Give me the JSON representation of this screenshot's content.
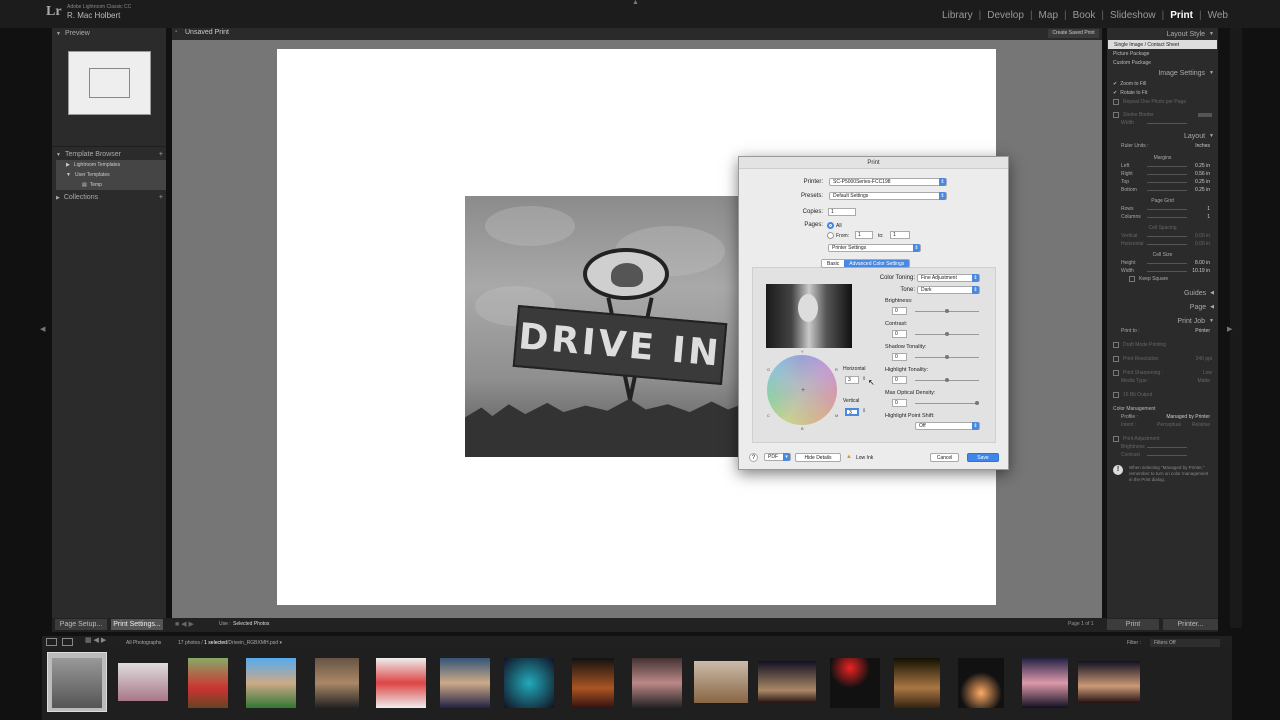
{
  "app": {
    "logo": "Lr",
    "name": "Adobe Lightroom Classic CC",
    "user": "R. Mac Holbert"
  },
  "modules": [
    {
      "label": "Library"
    },
    {
      "label": "Develop"
    },
    {
      "label": "Map"
    },
    {
      "label": "Book"
    },
    {
      "label": "Slideshow"
    },
    {
      "label": "Print",
      "active": true
    },
    {
      "label": "Web"
    }
  ],
  "left_panel": {
    "preview_title": "Preview",
    "template_browser_title": "Template Browser",
    "template_items": [
      "Lightroom Templates",
      "User Templates",
      "Temp"
    ],
    "collections_title": "Collections"
  },
  "center": {
    "title": "Unsaved Print",
    "create_saved": "Create Saved Print",
    "sign_text": "DRIVE IN"
  },
  "right_panel": {
    "layout_style_title": "Layout Style",
    "layout_styles": [
      "Single Image / Contact Sheet",
      "Picture Package",
      "Custom Package"
    ],
    "image_settings_title": "Image Settings",
    "image_settings": [
      {
        "label": "Zoom to Fill",
        "checked": true
      },
      {
        "label": "Rotate to Fit",
        "checked": true
      },
      {
        "label": "Repeat One Photo per Page",
        "checked": false
      },
      {
        "label": "Stroke Border",
        "checked": false
      }
    ],
    "stroke_width_label": "Width",
    "layout_title": "Layout",
    "ruler_units_label": "Ruler Units :",
    "ruler_units_value": "Inches",
    "margins_label": "Margins",
    "margins": [
      {
        "label": "Left",
        "value": "0.25 in"
      },
      {
        "label": "Right",
        "value": "0.56 in"
      },
      {
        "label": "Top",
        "value": "0.25 in"
      },
      {
        "label": "Bottom",
        "value": "0.25 in"
      }
    ],
    "page_grid_label": "Page Grid",
    "page_grid": [
      {
        "label": "Rows",
        "value": "1"
      },
      {
        "label": "Columns",
        "value": "1"
      }
    ],
    "cell_spacing_label": "Cell Spacing",
    "cell_spacing": [
      {
        "label": "Vertical",
        "value": "0.00 in"
      },
      {
        "label": "Horizontal",
        "value": "0.00 in"
      }
    ],
    "cell_size_label": "Cell Size",
    "cell_size": [
      {
        "label": "Height",
        "value": "8.00 in"
      },
      {
        "label": "Width",
        "value": "10.19 in"
      }
    ],
    "keep_square_label": "Keep Square",
    "guides_title": "Guides",
    "page_title": "Page",
    "print_job_title": "Print Job",
    "print_to_label": "Print to :",
    "print_to_value": "Printer",
    "draft_mode": "Draft Mode Printing",
    "print_resolution": "Print Resolution",
    "print_resolution_value": "240 ppi",
    "print_sharpening": "Print Sharpening :",
    "print_sharpening_value": "Low",
    "media_type": "Media Type :",
    "media_type_value": "Matte",
    "bit_output": "16 Bit Output",
    "color_management": "Color Management",
    "profile_label": "Profile :",
    "profile_value": "Managed by Printer",
    "intent_label": "Intent :",
    "intent_perceptual": "Perceptual",
    "intent_relative": "Relative",
    "print_adjustment": "Print Adjustment",
    "brightness_label": "Brightness",
    "contrast_label": "Contrast",
    "note": "When selecting \"Managed by Printer,\" remember to turn on color management in the Print dialog."
  },
  "bottom": {
    "page_setup": "Page Setup...",
    "print_settings": "Print Settings...",
    "use_label": "Use :",
    "use_value": "Selected Photos",
    "page_of": "Page 1 of 1",
    "print": "Print",
    "printer": "Printer..."
  },
  "filmstrip_bar": {
    "source": "All Photographs",
    "count": "17 photos /",
    "selected": "1 selected",
    "filename": "/Drivein_RGBXMH.psd",
    "filter_label": "Filter :",
    "filter_value": "Filters Off"
  },
  "dialog": {
    "title": "Print",
    "printer_label": "Printer:",
    "printer_value": "SC-P5000Series-FCC198",
    "presets_label": "Presets:",
    "presets_value": "Default Settings",
    "copies_label": "Copies:",
    "copies_value": "1",
    "pages_label": "Pages:",
    "pages_all": "All",
    "pages_from": "From:",
    "pages_from_value": "1",
    "pages_to": "to:",
    "pages_to_value": "1",
    "section_value": "Printer Settings",
    "tabs": [
      "Basic",
      "Advanced Color Settings"
    ],
    "color_toning_label": "Color Toning:",
    "color_toning_value": "Fine Adjustment",
    "tone_label": "Tone:",
    "tone_value": "Dark",
    "brightness_label": "Brightness:",
    "brightness_value": "0",
    "contrast_label": "Contrast:",
    "contrast_value": "0",
    "shadow_label": "Shadow Tonality:",
    "shadow_value": "0",
    "highlight_label": "Highlight Tonality:",
    "highlight_value": "0",
    "max_density_label": "Max Optical Density:",
    "max_density_value": "0",
    "hl_shift_label": "Highlight Point Shift:",
    "hl_shift_value": "Off",
    "horizontal_label": "Horizontal",
    "horizontal_value": "3",
    "vertical_label": "Vertical",
    "vertical_value": "3",
    "wheel_labels": {
      "y": "Y",
      "g": "G",
      "r": "R",
      "c": "C",
      "m": "M",
      "b": "B"
    },
    "help": "?",
    "pdf": "PDF",
    "hide_details": "Hide Details",
    "low_ink": "Low Ink",
    "cancel": "Cancel",
    "save": "Save"
  }
}
